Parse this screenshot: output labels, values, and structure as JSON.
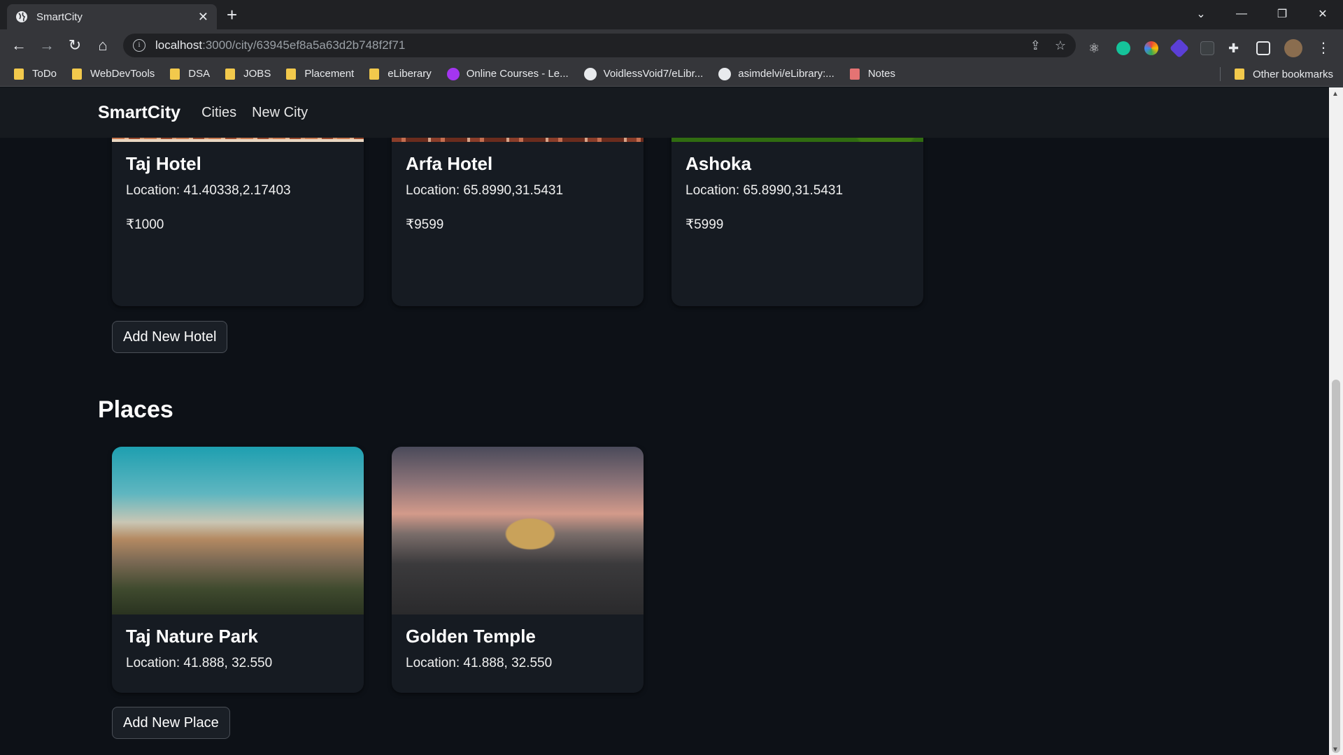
{
  "browser": {
    "tab_title": "SmartCity",
    "tab_close": "✕",
    "new_tab": "+",
    "url_host": "localhost",
    "url_path": ":3000/city/63945ef8a5a63d2b748f2f71",
    "bookmarks": [
      {
        "label": "ToDo",
        "icon": "folder-icon"
      },
      {
        "label": "WebDevTools",
        "icon": "folder-icon"
      },
      {
        "label": "DSA",
        "icon": "folder-icon"
      },
      {
        "label": "JOBS",
        "icon": "folder-icon"
      },
      {
        "label": "Placement",
        "icon": "folder-icon"
      },
      {
        "label": "eLiberary",
        "icon": "folder-icon"
      },
      {
        "label": "Online Courses - Le...",
        "icon": "udemy-icon"
      },
      {
        "label": "VoidlessVoid7/eLibr...",
        "icon": "github-icon"
      },
      {
        "label": "asimdelvi/eLibrary:...",
        "icon": "github-icon"
      },
      {
        "label": "Notes",
        "icon": "notes-icon"
      }
    ],
    "other_bookmarks": "Other bookmarks"
  },
  "navbar": {
    "brand": "SmartCity",
    "links": [
      "Cities",
      "New City"
    ]
  },
  "hotels": [
    {
      "name": "Taj Hotel",
      "location": "Location: 41.40338,2.17403",
      "price": "₹1000"
    },
    {
      "name": "Arfa Hotel",
      "location": "Location: 65.8990,31.5431",
      "price": "₹9599"
    },
    {
      "name": "Ashoka",
      "location": "Location: 65.8990,31.5431",
      "price": "₹5999"
    }
  ],
  "add_hotel_label": "Add New Hotel",
  "places_title": "Places",
  "places": [
    {
      "name": "Taj Nature Park",
      "location": "Location: 41.888, 32.550"
    },
    {
      "name": "Golden Temple",
      "location": "Location: 41.888, 32.550"
    }
  ],
  "add_place_label": "Add New Place",
  "colors": {
    "page_bg": "#0d1117",
    "card_bg": "#161b22",
    "navbar_bg": "#161a1f"
  }
}
